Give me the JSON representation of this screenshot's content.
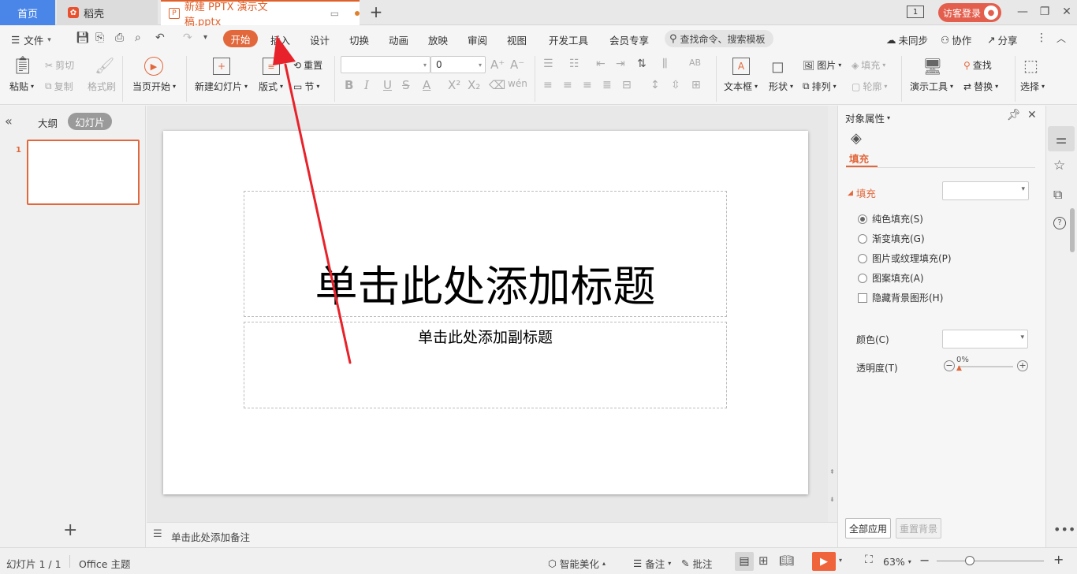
{
  "titlebar": {
    "tab_home": "首页",
    "tab_docer": "稻壳",
    "tab_doc": "新建 PPTX 演示文稿.pptx",
    "login": "访客登录",
    "page_badge": "1"
  },
  "menubar": {
    "file": "文件",
    "tabs": [
      "开始",
      "插入",
      "设计",
      "切换",
      "动画",
      "放映",
      "审阅",
      "视图",
      "开发工具",
      "会员专享"
    ],
    "search": "查找命令、搜索模板",
    "sync": "未同步",
    "collab": "协作",
    "share": "分享"
  },
  "ribbon": {
    "paste": "粘贴",
    "cut": "剪切",
    "copy": "复制",
    "format_painter": "格式刷",
    "from_current": "当页开始",
    "new_slide": "新建幻灯片",
    "layout": "版式",
    "reset": "重置",
    "section": "节",
    "font_size": "0",
    "textbox": "文本框",
    "shape": "形状",
    "picture": "图片",
    "fill": "填充",
    "arrange": "排列",
    "outline": "轮廓",
    "present_tools": "演示工具",
    "find": "查找",
    "replace": "替换",
    "select": "选择"
  },
  "leftpanel": {
    "outline": "大纲",
    "slides": "幻灯片",
    "slide_number": "1"
  },
  "slide": {
    "title_placeholder": "单击此处添加标题",
    "subtitle_placeholder": "单击此处添加副标题"
  },
  "notes": {
    "placeholder": "单击此处添加备注"
  },
  "rightpanel": {
    "header": "对象属性",
    "tab_fill": "填充",
    "section_fill": "填充",
    "options": [
      "纯色填充(S)",
      "渐变填充(G)",
      "图片或纹理填充(P)",
      "图案填充(A)"
    ],
    "hide_bg": "隐藏背景图形(H)",
    "color_label": "颜色(C)",
    "transparency_label": "透明度(T)",
    "transparency_value": "0%",
    "apply_all": "全部应用",
    "reset_bg": "重置背景"
  },
  "statusbar": {
    "slide_info": "幻灯片 1 / 1",
    "theme": "Office 主题",
    "beautify": "智能美化",
    "notes": "备注",
    "comment": "批注",
    "zoom": "63%"
  },
  "colors": {
    "accent": "#e2683c",
    "arrow": "#e8222a",
    "home_tab": "#4a86e8"
  }
}
